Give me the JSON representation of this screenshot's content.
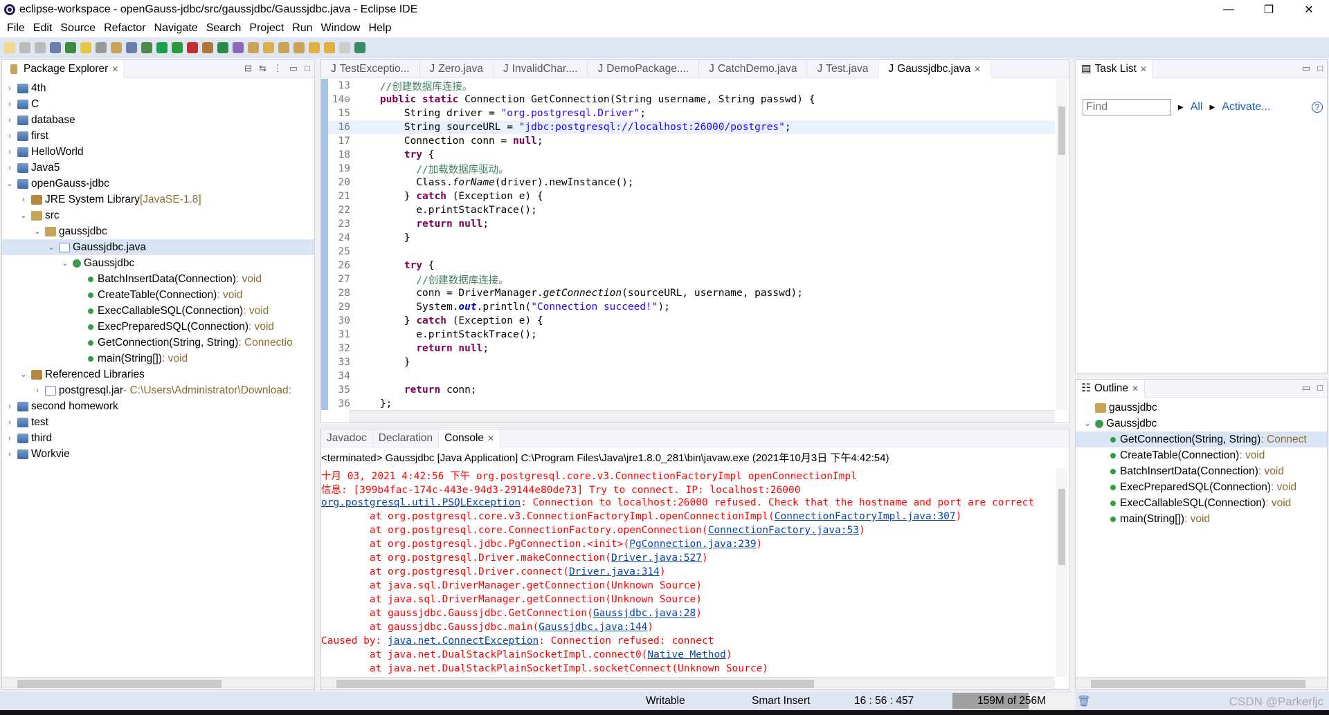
{
  "window": {
    "title": "eclipse-workspace - openGauss-jdbc/src/gaussjdbc/Gaussjdbc.java - Eclipse IDE",
    "minimize": "—",
    "restore": "❐",
    "close": "✕"
  },
  "menu": [
    "File",
    "Edit",
    "Source",
    "Refactor",
    "Navigate",
    "Search",
    "Project",
    "Run",
    "Window",
    "Help"
  ],
  "package_explorer": {
    "title": "Package Explorer",
    "items": [
      {
        "d": 0,
        "a": ">",
        "i": "proj",
        "t": "4th"
      },
      {
        "d": 0,
        "a": ">",
        "i": "proj",
        "t": "C"
      },
      {
        "d": 0,
        "a": ">",
        "i": "proj",
        "t": "database"
      },
      {
        "d": 0,
        "a": ">",
        "i": "proj",
        "t": "first"
      },
      {
        "d": 0,
        "a": ">",
        "i": "proj",
        "t": "HelloWorld"
      },
      {
        "d": 0,
        "a": ">",
        "i": "proj",
        "t": "Java5"
      },
      {
        "d": 0,
        "a": "v",
        "i": "proj",
        "t": "openGauss-jdbc"
      },
      {
        "d": 1,
        "a": ">",
        "i": "lib",
        "t": "JRE System Library",
        "s": " [JavaSE-1.8]"
      },
      {
        "d": 1,
        "a": "v",
        "i": "pkg",
        "t": "src"
      },
      {
        "d": 2,
        "a": "v",
        "i": "pkg",
        "t": "gaussjdbc"
      },
      {
        "d": 3,
        "a": "v",
        "i": "java",
        "t": "Gaussjdbc.java",
        "sel": true
      },
      {
        "d": 4,
        "a": "v",
        "i": "cls",
        "t": "Gaussjdbc"
      },
      {
        "d": 5,
        "a": "",
        "i": "m",
        "t": "BatchInsertData(Connection)",
        "s": " : void"
      },
      {
        "d": 5,
        "a": "",
        "i": "m",
        "t": "CreateTable(Connection)",
        "s": " : void"
      },
      {
        "d": 5,
        "a": "",
        "i": "m",
        "t": "ExecCallableSQL(Connection)",
        "s": " : void"
      },
      {
        "d": 5,
        "a": "",
        "i": "m",
        "t": "ExecPreparedSQL(Connection)",
        "s": " : void"
      },
      {
        "d": 5,
        "a": "",
        "i": "m",
        "t": "GetConnection(String, String)",
        "s": " : Connectio"
      },
      {
        "d": 5,
        "a": "",
        "i": "m",
        "t": "main(String[])",
        "s": " : void"
      },
      {
        "d": 1,
        "a": "v",
        "i": "lib",
        "t": "Referenced Libraries"
      },
      {
        "d": 2,
        "a": ">",
        "i": "java",
        "t": "postgresql.jar",
        "s": " - C:\\Users\\Administrator\\Download:"
      },
      {
        "d": 0,
        "a": ">",
        "i": "proj",
        "t": "second homework"
      },
      {
        "d": 0,
        "a": ">",
        "i": "proj",
        "t": "test"
      },
      {
        "d": 0,
        "a": ">",
        "i": "proj",
        "t": "third"
      },
      {
        "d": 0,
        "a": ">",
        "i": "proj",
        "t": "Workvie"
      }
    ]
  },
  "editor": {
    "tabs": [
      "TestExceptio...",
      "Zero.java",
      "InvalidChar....",
      "DemoPackage....",
      "CatchDemo.java",
      "Test.java",
      "Gaussjdbc.java"
    ],
    "active_tab": 6,
    "lines": [
      {
        "n": "13",
        "s": [
          [
            "    //创建数据库连接。",
            "cm"
          ]
        ]
      },
      {
        "n": "14⊖",
        "s": [
          [
            "    ",
            ""
          ],
          [
            "public static ",
            "kw"
          ],
          [
            "Connection GetConnection(String username, String passwd) {",
            ""
          ]
        ]
      },
      {
        "n": "15",
        "s": [
          [
            "        String driver = ",
            ""
          ],
          [
            "\"org.postgresql.Driver\"",
            "str"
          ],
          [
            ";",
            ""
          ]
        ]
      },
      {
        "n": "16",
        "cur": true,
        "s": [
          [
            "        String sourceURL = ",
            ""
          ],
          [
            "\"jdbc:postgresql://localhost:26000/postgres\"",
            "str"
          ],
          [
            ";",
            ""
          ]
        ]
      },
      {
        "n": "17",
        "s": [
          [
            "        Connection conn = ",
            ""
          ],
          [
            "null",
            "kw"
          ],
          [
            ";",
            ""
          ]
        ]
      },
      {
        "n": "18",
        "s": [
          [
            "        ",
            ""
          ],
          [
            "try",
            "kw"
          ],
          [
            " {",
            ""
          ]
        ]
      },
      {
        "n": "19",
        "s": [
          [
            "          //加载数据库驱动。",
            "cm"
          ]
        ]
      },
      {
        "n": "20",
        "s": [
          [
            "          Class.",
            ""
          ],
          [
            "forName",
            "it"
          ],
          [
            "(driver).newInstance();",
            ""
          ]
        ]
      },
      {
        "n": "21",
        "s": [
          [
            "        } ",
            ""
          ],
          [
            "catch",
            "kw"
          ],
          [
            " (Exception e) {",
            ""
          ]
        ]
      },
      {
        "n": "22",
        "s": [
          [
            "          e.printStackTrace();",
            ""
          ]
        ]
      },
      {
        "n": "23",
        "s": [
          [
            "          ",
            ""
          ],
          [
            "return null",
            "kw"
          ],
          [
            ";",
            ""
          ]
        ]
      },
      {
        "n": "24",
        "s": [
          [
            "        }",
            ""
          ]
        ]
      },
      {
        "n": "25",
        "s": [
          [
            "",
            ""
          ]
        ]
      },
      {
        "n": "26",
        "s": [
          [
            "        ",
            ""
          ],
          [
            "try",
            "kw"
          ],
          [
            " {",
            ""
          ]
        ]
      },
      {
        "n": "27",
        "s": [
          [
            "          //创建数据库连接。",
            "cm"
          ]
        ]
      },
      {
        "n": "28",
        "s": [
          [
            "          conn = DriverManager.",
            ""
          ],
          [
            "getConnection",
            "it"
          ],
          [
            "(sourceURL, username, passwd);",
            ""
          ]
        ]
      },
      {
        "n": "29",
        "s": [
          [
            "          System.",
            ""
          ],
          [
            "out",
            "fld"
          ],
          [
            ".println(",
            ""
          ],
          [
            "\"Connection succeed!\"",
            "str"
          ],
          [
            ");",
            ""
          ]
        ]
      },
      {
        "n": "30",
        "s": [
          [
            "        } ",
            ""
          ],
          [
            "catch",
            "kw"
          ],
          [
            " (Exception e) {",
            ""
          ]
        ]
      },
      {
        "n": "31",
        "s": [
          [
            "          e.printStackTrace();",
            ""
          ]
        ]
      },
      {
        "n": "32",
        "s": [
          [
            "          ",
            ""
          ],
          [
            "return null",
            "kw"
          ],
          [
            ";",
            ""
          ]
        ]
      },
      {
        "n": "33",
        "s": [
          [
            "        }",
            ""
          ]
        ]
      },
      {
        "n": "34",
        "s": [
          [
            "",
            ""
          ]
        ]
      },
      {
        "n": "35",
        "s": [
          [
            "        ",
            ""
          ],
          [
            "return",
            "kw"
          ],
          [
            " conn;",
            ""
          ]
        ]
      },
      {
        "n": "36",
        "s": [
          [
            "    };",
            ""
          ]
        ]
      }
    ]
  },
  "console": {
    "tabs": [
      "Javadoc",
      "Declaration",
      "Console"
    ],
    "active_tab": 2,
    "header": "<terminated> Gaussjdbc [Java Application] C:\\Program Files\\Java\\jre1.8.0_281\\bin\\javaw.exe (2021年10月3日 下午4:42:54)",
    "lines": [
      {
        "s": [
          [
            "十月 03, 2021 4:42:56 下午 org.postgresql.core.v3.ConnectionFactoryImpl openConnectionImpl",
            "red"
          ]
        ]
      },
      {
        "s": [
          [
            "信息: [399b4fac-174c-443e-94d3-29144e80de73] Try to connect. IP: localhost:26000",
            "red"
          ]
        ]
      },
      {
        "s": [
          [
            "org.postgresql.util.PSQLException",
            "lnk"
          ],
          [
            ": Connection to localhost:26000 refused. Check that the hostname and port are correct",
            "red"
          ]
        ]
      },
      {
        "s": [
          [
            "\tat org.postgresql.core.v3.ConnectionFactoryImpl.openConnectionImpl(",
            "red"
          ],
          [
            "ConnectionFactoryImpl.java:307",
            "lnk"
          ],
          [
            ")",
            "red"
          ]
        ]
      },
      {
        "s": [
          [
            "\tat org.postgresql.core.ConnectionFactory.openConnection(",
            "red"
          ],
          [
            "ConnectionFactory.java:53",
            "lnk"
          ],
          [
            ")",
            "red"
          ]
        ]
      },
      {
        "s": [
          [
            "\tat org.postgresql.jdbc.PgConnection.<init>(",
            "red"
          ],
          [
            "PgConnection.java:239",
            "lnk"
          ],
          [
            ")",
            "red"
          ]
        ]
      },
      {
        "s": [
          [
            "\tat org.postgresql.Driver.makeConnection(",
            "red"
          ],
          [
            "Driver.java:527",
            "lnk"
          ],
          [
            ")",
            "red"
          ]
        ]
      },
      {
        "s": [
          [
            "\tat org.postgresql.Driver.connect(",
            "red"
          ],
          [
            "Driver.java:314",
            "lnk"
          ],
          [
            ")",
            "red"
          ]
        ]
      },
      {
        "s": [
          [
            "\tat java.sql.DriverManager.getConnection(Unknown Source)",
            "red"
          ]
        ]
      },
      {
        "s": [
          [
            "\tat java.sql.DriverManager.getConnection(Unknown Source)",
            "red"
          ]
        ]
      },
      {
        "s": [
          [
            "\tat gaussjdbc.Gaussjdbc.GetConnection(",
            "red"
          ],
          [
            "Gaussjdbc.java:28",
            "lnk"
          ],
          [
            ")",
            "red"
          ]
        ]
      },
      {
        "s": [
          [
            "\tat gaussjdbc.Gaussjdbc.main(",
            "red"
          ],
          [
            "Gaussjdbc.java:144",
            "lnk"
          ],
          [
            ")",
            "red"
          ]
        ]
      },
      {
        "s": [
          [
            "Caused by: ",
            "red"
          ],
          [
            "java.net.ConnectException",
            "lnk"
          ],
          [
            ": Connection refused: connect",
            "red"
          ]
        ]
      },
      {
        "s": [
          [
            "\tat java.net.DualStackPlainSocketImpl.connect0(",
            "red"
          ],
          [
            "Native Method",
            "lnk"
          ],
          [
            ")",
            "red"
          ]
        ]
      },
      {
        "s": [
          [
            "\tat java.net.DualStackPlainSocketImpl.socketConnect(Unknown Source)",
            "red"
          ]
        ]
      }
    ]
  },
  "task_list": {
    "title": "Task List",
    "find_placeholder": "Find",
    "all": "All",
    "activate": "Activate...",
    "help": "?"
  },
  "outline": {
    "title": "Outline",
    "items": [
      {
        "d": 0,
        "a": "",
        "i": "pkg",
        "t": "gaussjdbc"
      },
      {
        "d": 0,
        "a": "v",
        "i": "cls",
        "t": "Gaussjdbc"
      },
      {
        "d": 1,
        "a": "",
        "i": "m",
        "t": "GetConnection(String, String)",
        "s": " : Connect",
        "sel": true
      },
      {
        "d": 1,
        "a": "",
        "i": "m",
        "t": "CreateTable(Connection)",
        "s": " : void"
      },
      {
        "d": 1,
        "a": "",
        "i": "m",
        "t": "BatchInsertData(Connection)",
        "s": " : void"
      },
      {
        "d": 1,
        "a": "",
        "i": "m",
        "t": "ExecPreparedSQL(Connection)",
        "s": " : void"
      },
      {
        "d": 1,
        "a": "",
        "i": "m",
        "t": "ExecCallableSQL(Connection)",
        "s": " : void"
      },
      {
        "d": 1,
        "a": "",
        "i": "m",
        "t": "main(String[])",
        "s": " : void"
      }
    ]
  },
  "status": {
    "writable": "Writable",
    "insert_mode": "Smart Insert",
    "position": "16 : 56 : 457",
    "heap": "159M of 256M",
    "heap_used_fraction": 0.62,
    "watermark": "CSDN @Parkerljc"
  }
}
